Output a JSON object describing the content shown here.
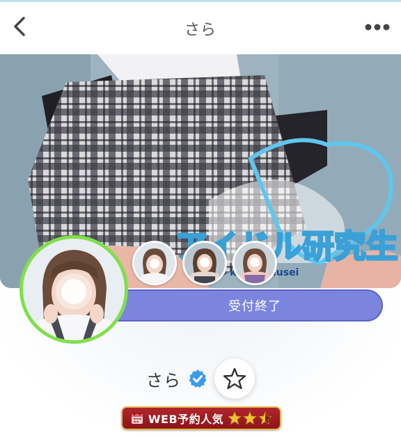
{
  "header": {
    "title": "さら",
    "back_icon": "chevron-left-icon",
    "more_icon": "more-dots-icon"
  },
  "banner": {
    "logo_text": "アイドル研究生",
    "logo_subtext": "kennkyuusei"
  },
  "profile": {
    "status_label": "受付終了",
    "name": "さら",
    "verified_icon": "verified-check-icon",
    "favorite_icon": "star-outline-icon"
  },
  "badge": {
    "label": "WEB予約人気",
    "icon": "calendar-icon",
    "stars": 2.5,
    "max_stars": 3
  },
  "colors": {
    "avatar_ring": "#7fe04a",
    "status_bar": "#7b85de",
    "verified": "#3d9be9",
    "badge": "#a81d24",
    "gold": "#e3b64f"
  }
}
